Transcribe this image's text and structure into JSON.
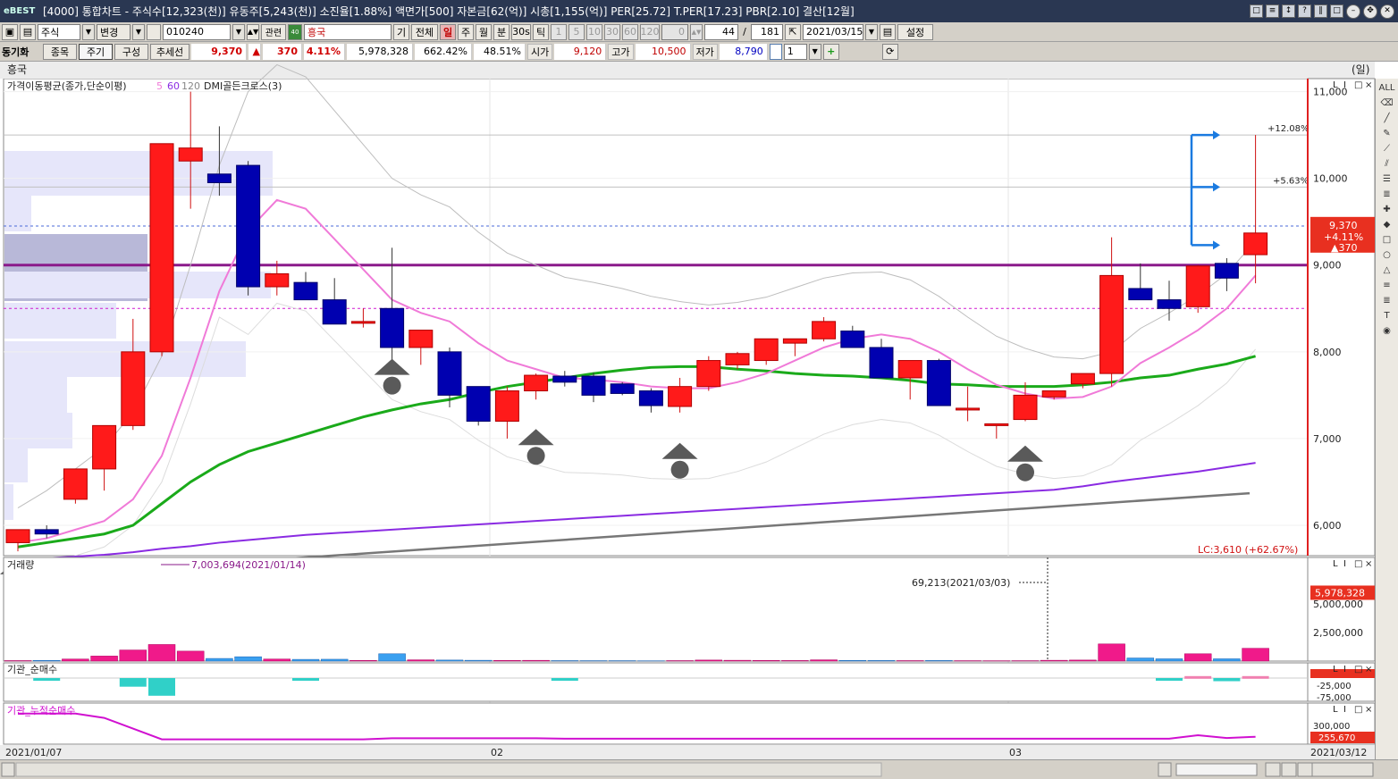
{
  "window": {
    "logo": "eBEST",
    "title": "[4000] 통합차트 - 주식수[12,323(천)] 유동주[5,243(천)] 소진율[1.88%] 액면가[500] 자본금[62(억)] 시총[1,155(억)] PER[25.72] T.PER[17.23] PBR[2.10] 결산[12월]",
    "buttons": [
      "□",
      "≡",
      "↕",
      "?",
      "‖",
      "□"
    ]
  },
  "toolbar": {
    "market": "주식",
    "change": "변경",
    "code": "010240",
    "related": "관련",
    "stock_name": "흥국",
    "btn_gi": "기",
    "btn_all": "전체",
    "periods": [
      "일",
      "주",
      "월",
      "분",
      "30s",
      "틱"
    ],
    "minutes": [
      "1",
      "5",
      "10",
      "30",
      "60",
      "120"
    ],
    "zero": "0",
    "count": "44",
    "slash": "/",
    "total": "181",
    "date": "2021/03/15",
    "settings": "설정"
  },
  "infobar": {
    "sync": "동기화",
    "tabs": [
      "종목",
      "주기",
      "구성",
      "추세선"
    ],
    "price": "9,370",
    "updown": "▲",
    "change": "370",
    "rate": "4.11%",
    "volume": "5,978,328",
    "vol_rate": "662.42%",
    "vol_rate2": "48.51%",
    "open_label": "시가",
    "open": "9,120",
    "high_label": "고가",
    "high": "10,500",
    "low_label": "저가",
    "low": "8,790",
    "spin": "1"
  },
  "chart": {
    "stock": "흥국",
    "unit": "(일)",
    "legend_title": "가격이동평균(종가,단순이평)",
    "legend_periods": [
      "5",
      "60",
      "120"
    ],
    "legend_dmi": "DMI골든크로스(3)",
    "price_ticks": [
      "11,000",
      "10,000",
      "9,000",
      "8,000",
      "7,000",
      "6,000"
    ],
    "pct_high": "+12.08%",
    "pct_mid": "+5.63%",
    "cur_price": "9,370",
    "cur_rate": "+4.11%",
    "cur_change": "▲370",
    "lc_label": "LC:3,610 (+62.67%)",
    "volume_title": "거래량",
    "vol_max_note": "7,003,694(2021/01/14)",
    "vol_min_note": "69,213(2021/03/03)",
    "vol_ticks": [
      "5,000,000",
      "2,500,000"
    ],
    "vol_current": "5,978,328",
    "inst_title": "기관_순매수",
    "inst_ticks": [
      "-25,000",
      "-75,000"
    ],
    "cum_title": "기관_누적순매수",
    "cum_tick": "300,000",
    "cum_current": "255,670",
    "x_labels": [
      "2021/01/07",
      "02",
      "03",
      "2021/03/12"
    ]
  },
  "colors": {
    "up": "#ff1a1a",
    "down": "#0000b0",
    "ma5": "#f07ad8",
    "ma60": "#1aaa1a",
    "ma120": "#8a2be2",
    "vol_up": "#f01a8a",
    "vol_down": "#3aa0f0"
  },
  "chart_data": {
    "type": "candlestick",
    "candles": [
      {
        "o": 5800,
        "h": 5950,
        "l": 5700,
        "c": 5950
      },
      {
        "o": 5950,
        "h": 6000,
        "l": 5850,
        "c": 5900
      },
      {
        "o": 6300,
        "h": 6650,
        "l": 6250,
        "c": 6650
      },
      {
        "o": 6650,
        "h": 7150,
        "l": 6400,
        "c": 7150
      },
      {
        "o": 7150,
        "h": 8380,
        "l": 7100,
        "c": 8000
      },
      {
        "o": 8000,
        "h": 10400,
        "l": 7950,
        "c": 10400
      },
      {
        "o": 10200,
        "h": 11000,
        "l": 9650,
        "c": 10350
      },
      {
        "o": 10050,
        "h": 10600,
        "l": 9800,
        "c": 9950
      },
      {
        "o": 10150,
        "h": 10200,
        "l": 8650,
        "c": 8750
      },
      {
        "o": 8750,
        "h": 9050,
        "l": 8650,
        "c": 8900
      },
      {
        "o": 8800,
        "h": 8920,
        "l": 8600,
        "c": 8600
      },
      {
        "o": 8600,
        "h": 8850,
        "l": 8350,
        "c": 8320
      },
      {
        "o": 8350,
        "h": 8500,
        "l": 8280,
        "c": 8350
      },
      {
        "o": 8500,
        "h": 9200,
        "l": 7900,
        "c": 8050
      },
      {
        "o": 8050,
        "h": 8250,
        "l": 7850,
        "c": 8250
      },
      {
        "o": 8000,
        "h": 8050,
        "l": 7360,
        "c": 7500
      },
      {
        "o": 7600,
        "h": 7600,
        "l": 7150,
        "c": 7200
      },
      {
        "o": 7200,
        "h": 7600,
        "l": 7000,
        "c": 7550
      },
      {
        "o": 7550,
        "h": 7750,
        "l": 7450,
        "c": 7730
      },
      {
        "o": 7720,
        "h": 7780,
        "l": 7600,
        "c": 7650
      },
      {
        "o": 7720,
        "h": 7760,
        "l": 7420,
        "c": 7500
      },
      {
        "o": 7630,
        "h": 7650,
        "l": 7500,
        "c": 7520
      },
      {
        "o": 7550,
        "h": 7580,
        "l": 7300,
        "c": 7380
      },
      {
        "o": 7370,
        "h": 7700,
        "l": 7300,
        "c": 7600
      },
      {
        "o": 7600,
        "h": 7950,
        "l": 7550,
        "c": 7900
      },
      {
        "o": 7850,
        "h": 8000,
        "l": 7800,
        "c": 7980
      },
      {
        "o": 7900,
        "h": 8150,
        "l": 7850,
        "c": 8150
      },
      {
        "o": 8100,
        "h": 8150,
        "l": 7950,
        "c": 8150
      },
      {
        "o": 8150,
        "h": 8400,
        "l": 8120,
        "c": 8350
      },
      {
        "o": 8240,
        "h": 8300,
        "l": 8050,
        "c": 8050
      },
      {
        "o": 8050,
        "h": 8150,
        "l": 7750,
        "c": 7700
      },
      {
        "o": 7700,
        "h": 7900,
        "l": 7450,
        "c": 7900
      },
      {
        "o": 7900,
        "h": 7920,
        "l": 7450,
        "c": 7380
      },
      {
        "o": 7350,
        "h": 7600,
        "l": 7200,
        "c": 7350
      },
      {
        "o": 7150,
        "h": 7170,
        "l": 7000,
        "c": 7170
      },
      {
        "o": 7220,
        "h": 7650,
        "l": 7200,
        "c": 7500
      },
      {
        "o": 7480,
        "h": 7550,
        "l": 7450,
        "c": 7550
      },
      {
        "o": 7630,
        "h": 7750,
        "l": 7580,
        "c": 7750
      },
      {
        "o": 7750,
        "h": 9320,
        "l": 7600,
        "c": 8880
      },
      {
        "o": 8730,
        "h": 9020,
        "l": 8600,
        "c": 8600
      },
      {
        "o": 8600,
        "h": 8820,
        "l": 8360,
        "c": 8500
      },
      {
        "o": 8520,
        "h": 9000,
        "l": 8450,
        "c": 8990
      },
      {
        "o": 9020,
        "h": 9080,
        "l": 8700,
        "c": 8850
      },
      {
        "o": 9120,
        "h": 10500,
        "l": 8790,
        "c": 9370
      }
    ],
    "ma5": [
      5800,
      5850,
      5950,
      6050,
      6300,
      6800,
      7700,
      8700,
      9400,
      9750,
      9650,
      9300,
      8950,
      8600,
      8450,
      8350,
      8100,
      7900,
      7800,
      7700,
      7680,
      7650,
      7600,
      7580,
      7580,
      7650,
      7750,
      7900,
      8050,
      8150,
      8200,
      8150,
      8000,
      7800,
      7620,
      7520,
      7460,
      7480,
      7600,
      7870,
      8050,
      8250,
      8500,
      8880
    ],
    "ma60": [
      5750,
      5800,
      5850,
      5900,
      6000,
      6250,
      6500,
      6700,
      6850,
      6950,
      7050,
      7150,
      7250,
      7330,
      7400,
      7450,
      7530,
      7600,
      7650,
      7700,
      7750,
      7790,
      7820,
      7830,
      7830,
      7800,
      7780,
      7750,
      7730,
      7720,
      7700,
      7670,
      7630,
      7620,
      7600,
      7600,
      7600,
      7620,
      7650,
      7700,
      7730,
      7800,
      7860,
      7950
    ],
    "ma120": [
      5600,
      5620,
      5640,
      5660,
      5690,
      5730,
      5760,
      5800,
      5830,
      5860,
      5890,
      5910,
      5930,
      5950,
      5970,
      5990,
      6010,
      6030,
      6050,
      6070,
      6090,
      6110,
      6130,
      6150,
      6170,
      6190,
      6210,
      6230,
      6250,
      6270,
      6290,
      6310,
      6330,
      6350,
      6370,
      6390,
      6410,
      6450,
      6500,
      6540,
      6580,
      6620,
      6670,
      6720
    ],
    "volume": [
      42000,
      62000,
      180000,
      440000,
      970000,
      1450000,
      870000,
      230000,
      380000,
      180000,
      150000,
      160000,
      60000,
      640000,
      110000,
      90000,
      70000,
      60000,
      65000,
      40000,
      35000,
      35000,
      25000,
      40000,
      90000,
      70000,
      60000,
      50000,
      110000,
      60000,
      50000,
      40000,
      50000,
      35000,
      30000,
      35000,
      69213,
      90000,
      1500000,
      270000,
      200000,
      640000,
      200000,
      1120000
    ],
    "inst_net": [
      0,
      -2000,
      0,
      0,
      -22000,
      -45000,
      0,
      0,
      0,
      0,
      -1000,
      0,
      0,
      0,
      0,
      0,
      0,
      0,
      0,
      -2000,
      0,
      0,
      0,
      0,
      0,
      0,
      0,
      0,
      0,
      0,
      0,
      0,
      0,
      0,
      0,
      0,
      0,
      0,
      0,
      0,
      -1000,
      5000,
      -8000,
      5000
    ],
    "inst_cum": [
      500000,
      500000,
      500000,
      480000,
      430000,
      380000,
      380000,
      380000,
      380000,
      380000,
      380000,
      380000,
      380000,
      385000,
      385000,
      385000,
      385000,
      385000,
      385000,
      383000,
      383000,
      383000,
      383000,
      383000,
      383000,
      383000,
      383000,
      383000,
      383000,
      383000,
      383000,
      383000,
      383000,
      383000,
      383000,
      383000,
      383000,
      383000,
      383000,
      383000,
      383000,
      399000,
      386000,
      392000
    ]
  }
}
